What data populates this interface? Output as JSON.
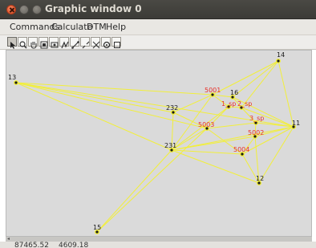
{
  "window": {
    "title": "Graphic window 0"
  },
  "menu": {
    "items": [
      "Commands",
      "Calculate",
      "DTM",
      "Help"
    ]
  },
  "toolbar": {
    "icons": [
      "pointer-icon",
      "zoom-icon",
      "pan-icon",
      "fit-icon",
      "zoom-window-icon",
      "draw-icon",
      "link-icon",
      "break-link-icon",
      "grid-icon",
      "settings-icon",
      "layers-icon"
    ]
  },
  "colors": {
    "canvas_bg": "#dadada",
    "line": "#f2ef3a",
    "black_label": "#1a1a1a",
    "red_label": "#e8312a",
    "point_fill": "#1a1a1a"
  },
  "points": [
    {
      "id": "p13",
      "label": "13",
      "label_color": "black"
    },
    {
      "id": "p14",
      "label": "14",
      "label_color": "black"
    },
    {
      "id": "p16",
      "label": "16",
      "label_color": "black"
    },
    {
      "id": "p232",
      "label": "232",
      "label_color": "black"
    },
    {
      "id": "p231",
      "label": "231",
      "label_color": "black"
    },
    {
      "id": "p11",
      "label": "11",
      "label_color": "black"
    },
    {
      "id": "p12",
      "label": "12",
      "label_color": "black"
    },
    {
      "id": "p15",
      "label": "15",
      "label_color": "black"
    },
    {
      "id": "p5001",
      "label": "5001",
      "label_color": "red"
    },
    {
      "id": "p1sp",
      "label": "1_sp",
      "label_color": "red"
    },
    {
      "id": "p2sp",
      "label": "2_sp",
      "label_color": "red"
    },
    {
      "id": "p3sp",
      "label": "3_sp",
      "label_color": "red"
    },
    {
      "id": "p5003",
      "label": "5003",
      "label_color": "red"
    },
    {
      "id": "p5002",
      "label": "5002",
      "label_color": "red"
    },
    {
      "id": "p5004",
      "label": "5004",
      "label_color": "red"
    }
  ],
  "status": {
    "x": "87465.52",
    "y": "4609.18"
  }
}
